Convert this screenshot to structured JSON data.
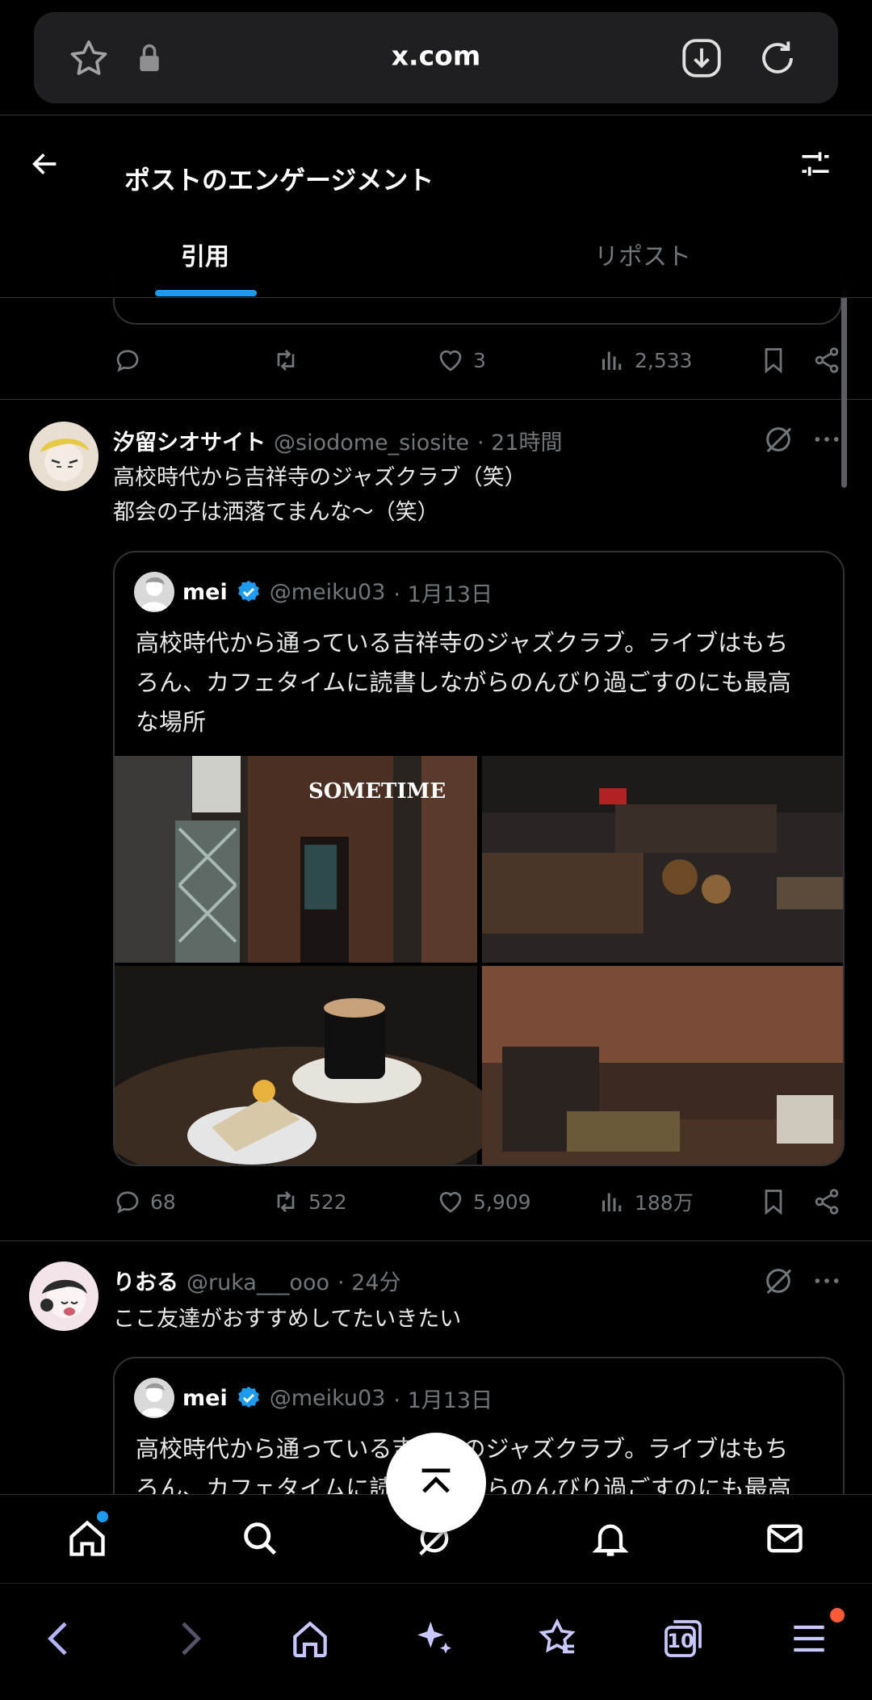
{
  "browser": {
    "domain": "x.com",
    "icons": [
      "star-icon",
      "lock-icon",
      "download-icon",
      "reload-icon"
    ],
    "bottom_icons": [
      "back-icon",
      "forward-icon",
      "home-icon",
      "sparkles-icon",
      "bookmarks-icon",
      "tabs-icon",
      "menu-icon"
    ],
    "tab_count": "10"
  },
  "header": {
    "title": "ポストのエンゲージメント",
    "tabs": [
      {
        "label": "引用",
        "active": true
      },
      {
        "label": "リポスト",
        "active": false
      }
    ]
  },
  "prev_post": {
    "likes": "3",
    "views": "2,533"
  },
  "posts": [
    {
      "name": "汐留シオサイト",
      "handle": "@siodome_siosite",
      "time": "· 21時間",
      "lines": [
        "高校時代から吉祥寺のジャズクラブ（笑）",
        "都会の子は洒落てまんな〜（笑）"
      ],
      "quote": {
        "name": "mei",
        "handle": "@meiku03",
        "time": "· 1月13日",
        "lines": [
          "高校時代から通っている吉祥寺のジャズクラブ。ライブはもち",
          "ろん、カフェタイムに読書しながらのんびり過ごすのにも最高",
          "な場所"
        ],
        "media_sign": "SOMETIME"
      },
      "replies": "68",
      "reposts": "522",
      "likes": "5,909",
      "views": "188万"
    },
    {
      "name": "りおる",
      "handle": "@ruka___ooo",
      "time": "· 24分",
      "lines": [
        "ここ友達がおすすめしてたいきたい"
      ],
      "quote": {
        "name": "mei",
        "handle": "@meiku03",
        "time": "· 1月13日",
        "lines": [
          "高校時代から通っている吉祥寺のジャズクラブ。ライブはもち",
          "ろん、カフェタイムに読書しながらのんびり過ごすのにも最高"
        ]
      }
    }
  ],
  "colors": {
    "accent": "#1d9bf0",
    "background": "#000000",
    "muted": "#71767b",
    "border": "#2f3336"
  }
}
